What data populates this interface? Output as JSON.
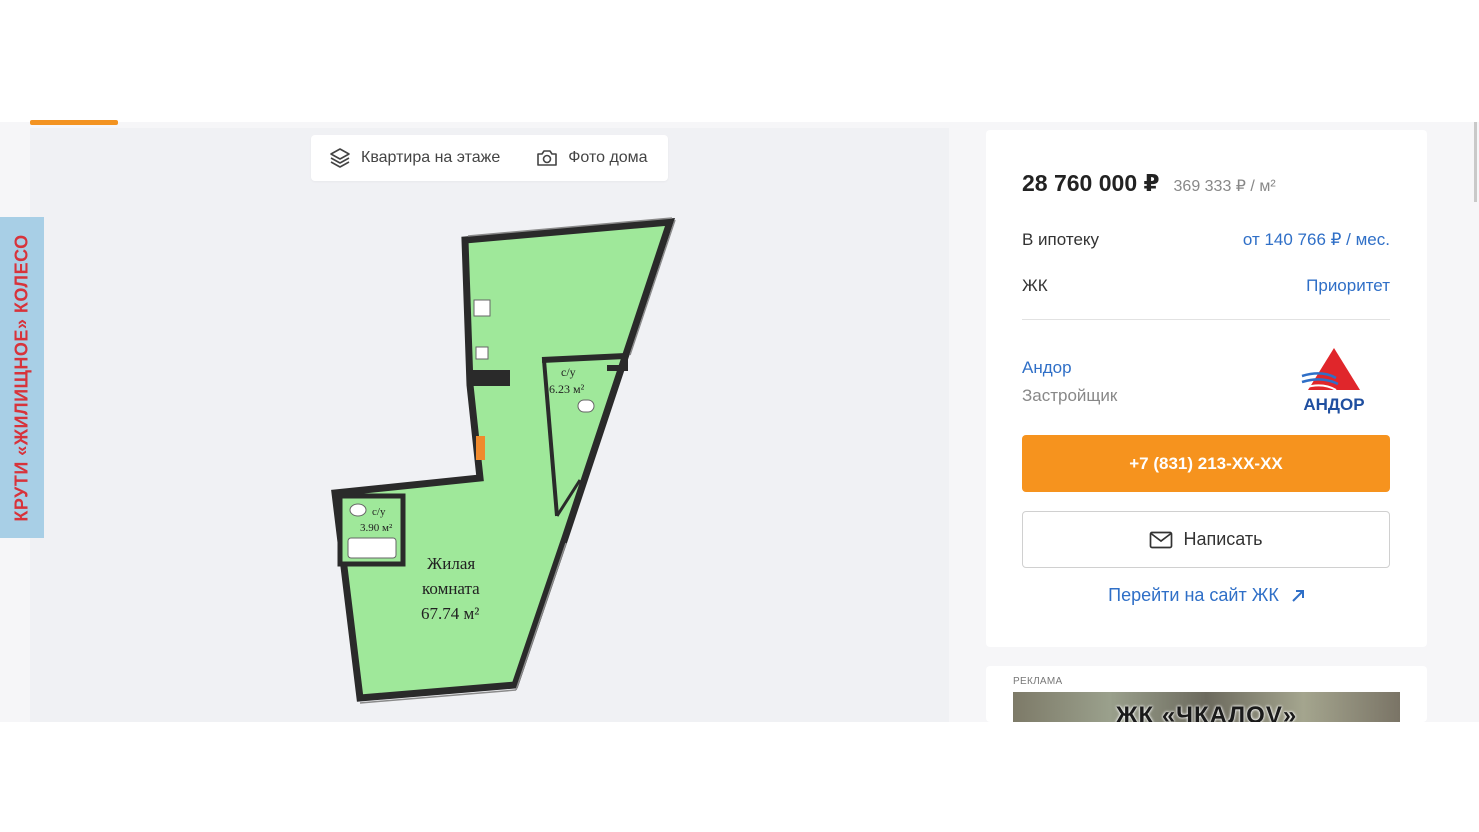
{
  "plan_tabs": {
    "floor_label": "Квартира на этаже",
    "photo_label": "Фото дома"
  },
  "side_banner": {
    "text": "КРУТИ «ЖИЛИЩНОЕ» КОЛЕСО"
  },
  "floorplan": {
    "bath1": {
      "name": "с/у",
      "area": "6.23 м²"
    },
    "bath2": {
      "name": "с/у",
      "area": "3.90 м²"
    },
    "living": {
      "name_line1": "Жилая",
      "name_line2": "комната",
      "area": "67.74 м²"
    }
  },
  "card": {
    "price": "28 760 000 ₽",
    "price_per_m2": "369 333 ₽ / м²",
    "mortgage_label": "В ипотеку",
    "mortgage_value": "от 140 766 ₽ / мес.",
    "complex_label": "ЖК",
    "complex_value": "Приоритет",
    "developer_name": "Андор",
    "developer_role": "Застройщик",
    "developer_logo_text": "АНДОР",
    "phone_button": "+7 (831) 213-XX-XX",
    "write_button": "Написать",
    "site_link": "Перейти на сайт ЖК"
  },
  "ad": {
    "label": "РЕКЛАМА",
    "banner_text": "ЖК «ЧКАЛОV»"
  },
  "colors": {
    "accent_orange": "#f6931e",
    "link_blue": "#2f6fc7",
    "plan_green": "#9fe89a",
    "logo_red": "#e0262b"
  }
}
